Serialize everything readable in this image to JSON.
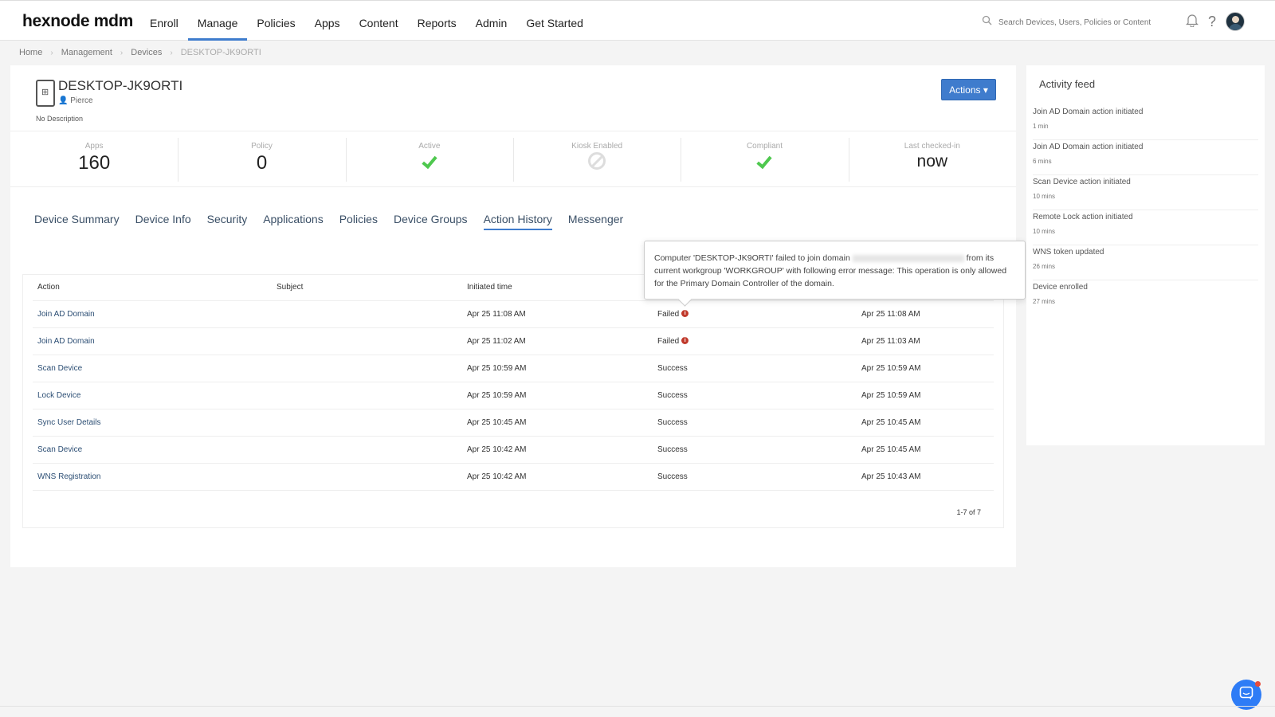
{
  "brand": "hexnode mdm",
  "nav": [
    "Enroll",
    "Manage",
    "Policies",
    "Apps",
    "Content",
    "Reports",
    "Admin",
    "Get Started"
  ],
  "search": {
    "placeholder": "Search Devices, Users, Policies or Content"
  },
  "breadcrumb": [
    "Home",
    "Management",
    "Devices",
    "DESKTOP-JK9ORTI"
  ],
  "device": {
    "name": "DESKTOP-JK9ORTI",
    "user": "Pierce",
    "description": "No Description",
    "actions_label": "Actions ▾"
  },
  "stats": {
    "apps": {
      "label": "Apps",
      "value": "160"
    },
    "policy": {
      "label": "Policy",
      "value": "0"
    },
    "active": {
      "label": "Active",
      "icon": "check-icon"
    },
    "kiosk": {
      "label": "Kiosk Enabled",
      "icon": "ban-icon"
    },
    "compliant": {
      "label": "Compliant",
      "icon": "check-icon"
    },
    "last_checked": {
      "label": "Last checked-in",
      "value": "now"
    }
  },
  "tabs": [
    "Device Summary",
    "Device Info",
    "Security",
    "Applications",
    "Policies",
    "Device Groups",
    "Action History",
    "Messenger"
  ],
  "table": {
    "headers": [
      "Action",
      "Subject",
      "Initiated time",
      "",
      ""
    ],
    "rows": [
      {
        "action": "Join AD Domain",
        "subject": "",
        "initiated": "Apr 25 11:08 AM",
        "status": "Failed",
        "failed": true,
        "completed": "Apr 25 11:08 AM"
      },
      {
        "action": "Join AD Domain",
        "subject": "",
        "initiated": "Apr 25 11:02 AM",
        "status": "Failed",
        "failed": true,
        "completed": "Apr 25 11:03 AM"
      },
      {
        "action": "Scan Device",
        "subject": "",
        "initiated": "Apr 25 10:59 AM",
        "status": "Success",
        "failed": false,
        "completed": "Apr 25 10:59 AM"
      },
      {
        "action": "Lock Device",
        "subject": "",
        "initiated": "Apr 25 10:59 AM",
        "status": "Success",
        "failed": false,
        "completed": "Apr 25 10:59 AM"
      },
      {
        "action": "Sync User Details",
        "subject": "",
        "initiated": "Apr 25 10:45 AM",
        "status": "Success",
        "failed": false,
        "completed": "Apr 25 10:45 AM"
      },
      {
        "action": "Scan Device",
        "subject": "",
        "initiated": "Apr 25 10:42 AM",
        "status": "Success",
        "failed": false,
        "completed": "Apr 25 10:45 AM"
      },
      {
        "action": "WNS Registration",
        "subject": "",
        "initiated": "Apr 25 10:42 AM",
        "status": "Success",
        "failed": false,
        "completed": "Apr 25 10:43 AM"
      }
    ],
    "pagination": "1-7 of 7"
  },
  "tooltip": {
    "before": "Computer 'DESKTOP-JK9ORTI' failed to join domain",
    "after": "from its current workgroup 'WORKGROUP' with following error message: This operation is only allowed for the Primary Domain Controller of the domain."
  },
  "feed": {
    "title": "Activity feed",
    "items": [
      {
        "text": "Join AD Domain action initiated",
        "time": "1 min"
      },
      {
        "text": "Join AD Domain action initiated",
        "time": "6 mins"
      },
      {
        "text": "Scan Device action initiated",
        "time": "10 mins"
      },
      {
        "text": "Remote Lock action initiated",
        "time": "10 mins"
      },
      {
        "text": "WNS token updated",
        "time": "26 mins"
      },
      {
        "text": "Device enrolled",
        "time": "27 mins"
      }
    ]
  },
  "colors": {
    "accent": "#3f7ccd",
    "success": "#4ec84e",
    "error": "#c0392b",
    "chat": "#2e7cf6"
  }
}
